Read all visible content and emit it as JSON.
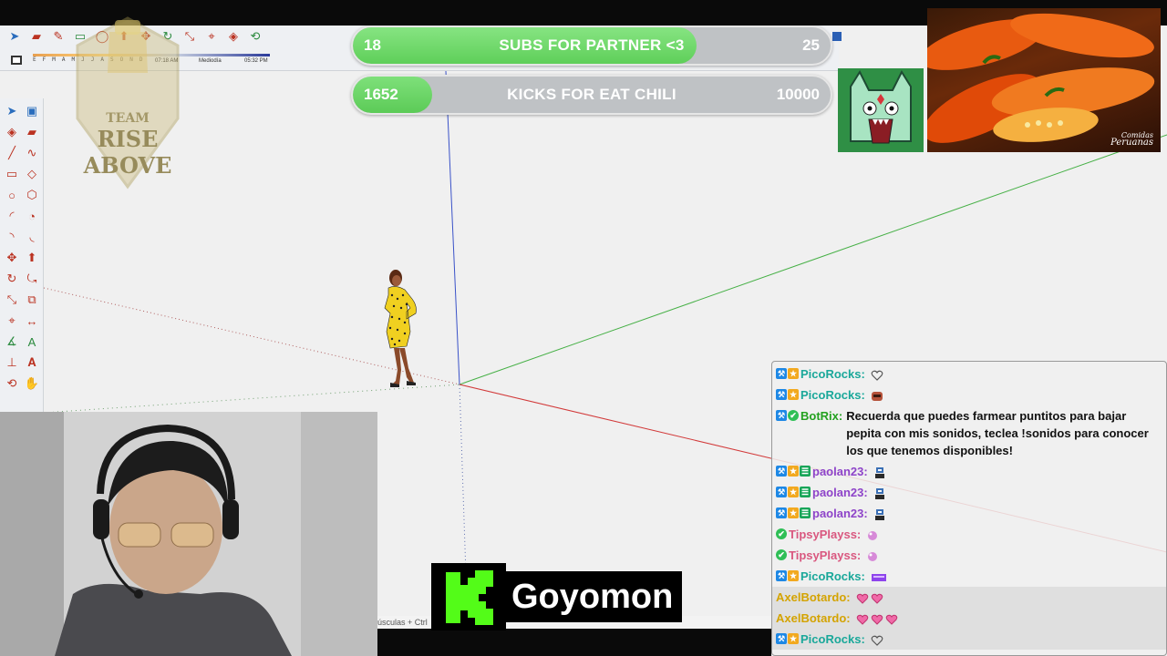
{
  "toolbar": {
    "months": [
      "E",
      "F",
      "M",
      "A",
      "M",
      "J",
      "J",
      "A",
      "S",
      "O",
      "N",
      "D"
    ],
    "time_start": "07:18 AM",
    "time_mid": "Mediodía",
    "time_end": "05:32 PM",
    "icons": [
      "select-icon",
      "eraser-icon",
      "pencil-icon",
      "rectangle-icon",
      "circle-icon",
      "pushpull-icon",
      "move-icon",
      "rotate-icon",
      "scale-icon",
      "tape-icon",
      "paint-icon",
      "orbit-icon"
    ]
  },
  "palette": {
    "icons": [
      "arrow-icon",
      "component-icon",
      "paint-bucket-icon",
      "eraser-icon",
      "line-icon",
      "freehand-icon",
      "rectangle-icon",
      "rotated-rect-icon",
      "circle-icon",
      "polygon-icon",
      "arc-icon",
      "pie-icon",
      "arc2-icon",
      "arc3-icon",
      "move-icon",
      "pushpull-icon",
      "rotate-icon",
      "followme-icon",
      "scale-icon",
      "offset-icon",
      "tape-icon",
      "dimension-icon",
      "protractor-icon",
      "text-icon",
      "axes-icon",
      "3dtext-icon",
      "orbit-icon",
      "pan-icon"
    ]
  },
  "logo": {
    "line1": "TEAM",
    "line2": "RISE ABOVE"
  },
  "goals": {
    "subs": {
      "current": "18",
      "title": "SUBS FOR PARTNER <3",
      "target": "25",
      "progress": 0.72
    },
    "kicks": {
      "current": "1652",
      "title": "KICKS FOR EAT CHILI",
      "target": "10000",
      "progress": 0.1652
    }
  },
  "chili": {
    "caption1": "Comidas",
    "caption2": "Peruanas"
  },
  "statusbar": {
    "text": "úsculas + Ctrl"
  },
  "kick_banner": {
    "logo_letter": "K",
    "name": "Goyomon"
  },
  "chat": {
    "messages": [
      {
        "badges": [
          "mod",
          "sub"
        ],
        "user": "PicoRocks:",
        "color": "#1aa89a",
        "text": "",
        "emote": "heart-outline"
      },
      {
        "badges": [
          "mod",
          "sub"
        ],
        "user": "PicoRocks:",
        "color": "#1aa89a",
        "text": "",
        "emote": "face"
      },
      {
        "badges": [
          "mod",
          "bot"
        ],
        "user": "BotRix:",
        "color": "#23a11f",
        "text": "Recuerda que puedes farmear puntitos para bajar pepita con mis sonidos, teclea !sonidos para conocer los que tenemos disponibles!",
        "emote": ""
      },
      {
        "badges": [
          "mod",
          "sub",
          "og"
        ],
        "user": "paolan23:",
        "color": "#8e44c9",
        "text": "",
        "emote": "robot"
      },
      {
        "badges": [
          "mod",
          "sub",
          "og"
        ],
        "user": "paolan23:",
        "color": "#8e44c9",
        "text": "",
        "emote": "robot"
      },
      {
        "badges": [
          "mod",
          "sub",
          "og"
        ],
        "user": "paolan23:",
        "color": "#8e44c9",
        "text": "",
        "emote": "robot"
      },
      {
        "badges": [
          "bot"
        ],
        "user": "TipsyPlayss:",
        "color": "#d9577f",
        "text": "",
        "emote": "bubble"
      },
      {
        "badges": [
          "bot"
        ],
        "user": "TipsyPlayss:",
        "color": "#d9577f",
        "text": "",
        "emote": "bubble"
      },
      {
        "badges": [
          "mod",
          "sub"
        ],
        "user": "PicoRocks:",
        "color": "#1aa89a",
        "text": "",
        "emote": "bar"
      },
      {
        "badges": [],
        "user": "AxelBotardo:",
        "color": "#d4a300",
        "text": "",
        "emote": "hearts2"
      },
      {
        "badges": [],
        "user": "AxelBotardo:",
        "color": "#d4a300",
        "text": "",
        "emote": "hearts3"
      },
      {
        "badges": [
          "mod",
          "sub"
        ],
        "user": "PicoRocks:",
        "color": "#1aa89a",
        "text": "",
        "emote": "heart-outline"
      }
    ]
  },
  "colors": {
    "goal_green": "#5ccb57",
    "goal_track": "#bfc2c5",
    "axis_red": "#d23a3a",
    "axis_green": "#46b046",
    "axis_blue": "#3a52c8"
  }
}
